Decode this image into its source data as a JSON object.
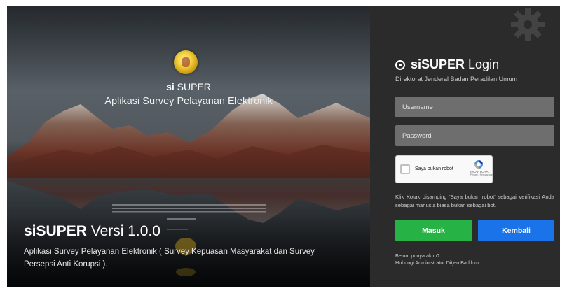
{
  "hero": {
    "brand_bold": "si",
    "brand_rest": "SUPER",
    "tagline": "Aplikasi Survey Pelayanan Elektronik",
    "version_bold": "siSUPER",
    "version_rest": "Versi 1.0.0",
    "description": "Aplikasi Survey Pelayanan Elektronik ( Survey Kepuasan Masyarakat dan Survey Persepsi Anti Korupsi )."
  },
  "login": {
    "title_bold": "siSUPER",
    "title_rest": "Login",
    "subtitle": "Direktorat Jenderal Badan Peradilan Umum",
    "username_placeholder": "Username",
    "password_placeholder": "Password",
    "captcha_label": "Saya bukan robot",
    "captcha_brand": "reCAPTCHA",
    "captcha_terms": "Privasi - Persyaratan",
    "hint": "Klik Kotak disamping 'Saya bukan robot' sebagai verifikasi Anda sebagai manusia biasa bukan sebagai bot.",
    "submit_label": "Masuk",
    "back_label": "Kembali",
    "footer_line1": "Belum punya akun?",
    "footer_line2": "Hubungi Administrator Ditjen Badilum."
  },
  "colors": {
    "panel_bg": "#2b2b2b",
    "field_bg": "#6e6e6e",
    "submit_green": "#26b245",
    "back_blue": "#1a73e8"
  },
  "icons": [
    "logo-emblem-icon",
    "gear-icon",
    "target-icon",
    "recaptcha-icon"
  ]
}
